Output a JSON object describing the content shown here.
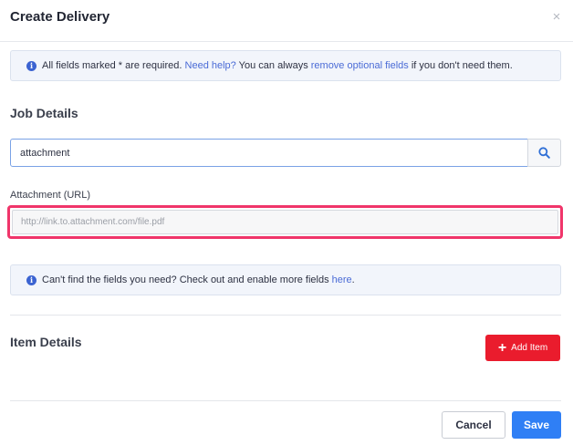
{
  "modal": {
    "title": "Create Delivery",
    "close_glyph": "×"
  },
  "required_alert": {
    "text_before": "All fields marked * are required. ",
    "help_link": "Need help?",
    "text_middle": " You can always ",
    "optional_link": "remove optional fields",
    "text_after": " if you don't need them."
  },
  "job_details": {
    "title": "Job Details",
    "search_value": "attachment",
    "attachment_label": "Attachment (URL)",
    "attachment_placeholder": "http://link.to.attachment.com/file.pdf"
  },
  "fields_alert": {
    "text_before": "Can't find the fields you need? Check out and enable more fields ",
    "here_link": "here",
    "text_after": "."
  },
  "item_details": {
    "title": "Item Details",
    "add_item_label": "Add Item",
    "add_item_icon": "plus-icon"
  },
  "footer": {
    "cancel_label": "Cancel",
    "save_label": "Save"
  },
  "colors": {
    "accent": "#2f7ff5",
    "danger": "#ea1c2d",
    "highlight": "#f0356a",
    "link": "#4a6bd6"
  }
}
